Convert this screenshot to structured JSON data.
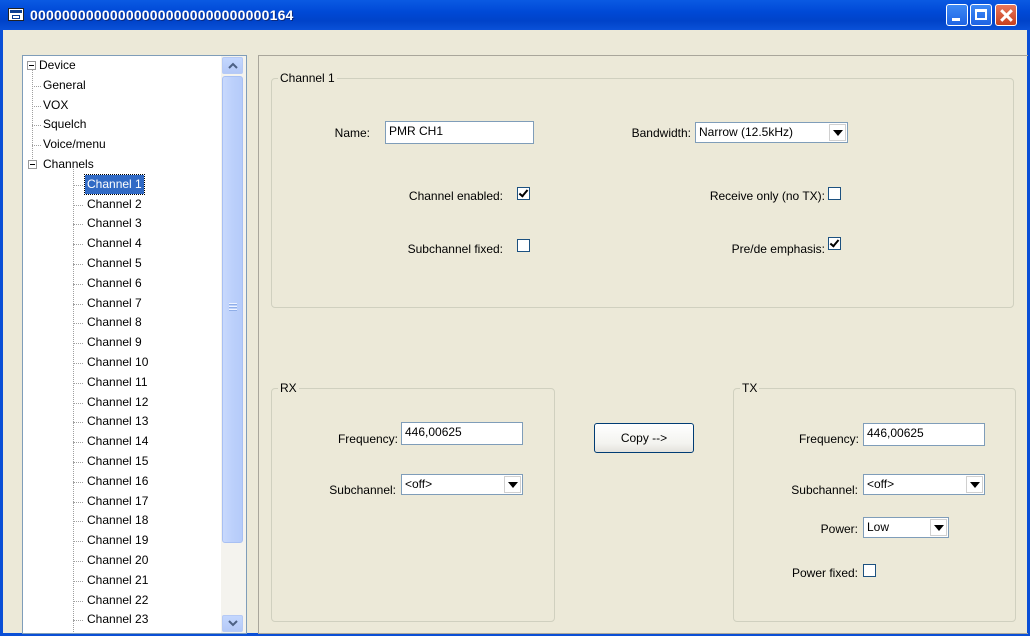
{
  "window": {
    "title": "000000000000000000000000000000164"
  },
  "tree": {
    "root": "Device",
    "device_children": [
      "General",
      "VOX",
      "Squelch",
      "Voice/menu"
    ],
    "channels_label": "Channels",
    "channels": [
      "Channel 1",
      "Channel 2",
      "Channel 3",
      "Channel 4",
      "Channel 5",
      "Channel 6",
      "Channel 7",
      "Channel 8",
      "Channel 9",
      "Channel 10",
      "Channel 11",
      "Channel 12",
      "Channel 13",
      "Channel 14",
      "Channel 15",
      "Channel 16",
      "Channel 17",
      "Channel 18",
      "Channel 19",
      "Channel 20",
      "Channel 21",
      "Channel 22",
      "Channel 23"
    ],
    "selected": "Channel 1"
  },
  "channel_group": {
    "legend": "Channel 1",
    "name_label": "Name:",
    "name_value": "PMR CH1",
    "bandwidth_label": "Bandwidth:",
    "bandwidth_value": "Narrow (12.5kHz)",
    "channel_enabled_label": "Channel enabled:",
    "channel_enabled": true,
    "receive_only_label": "Receive only (no TX):",
    "receive_only": false,
    "subchannel_fixed_label": "Subchannel fixed:",
    "subchannel_fixed": false,
    "emphasis_label": "Pre/de emphasis:",
    "emphasis": true
  },
  "rx": {
    "legend": "RX",
    "frequency_label": "Frequency:",
    "frequency_value": "446,00625",
    "subchannel_label": "Subchannel:",
    "subchannel_value": "<off>"
  },
  "copy_button": "Copy -->",
  "tx": {
    "legend": "TX",
    "frequency_label": "Frequency:",
    "frequency_value": "446,00625",
    "subchannel_label": "Subchannel:",
    "subchannel_value": "<off>",
    "power_label": "Power:",
    "power_value": "Low",
    "power_fixed_label": "Power fixed:",
    "power_fixed": false
  },
  "colors": {
    "titlebar": "#0049d6",
    "selection": "#316ac5",
    "window_bg": "#ece9d8"
  }
}
